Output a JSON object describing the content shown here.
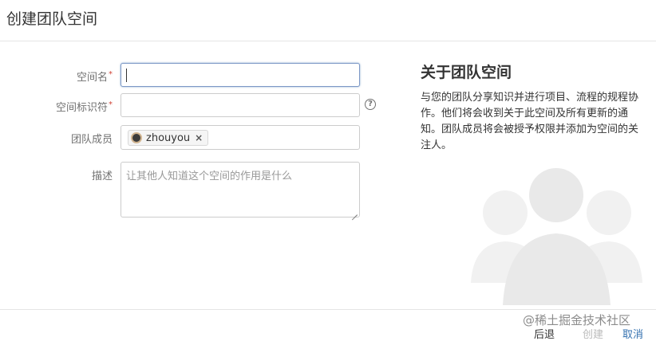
{
  "dialog": {
    "title": "创建团队空间"
  },
  "form": {
    "space_name": {
      "label": "空间名",
      "required_mark": "*",
      "value": ""
    },
    "space_key": {
      "label": "空间标识符",
      "required_mark": "*",
      "value": "",
      "help_icon": "question-circle-icon",
      "help_glyph": "?"
    },
    "members": {
      "label": "团队成员",
      "chips": [
        {
          "name": "zhouyou",
          "remove_glyph": "×"
        }
      ]
    },
    "description": {
      "label": "描述",
      "placeholder": "让其他人知道这个空间的作用是什么"
    }
  },
  "about": {
    "title": "关于团队空间",
    "text": "与您的团队分享知识并进行项目、流程的规程协作。他们将会收到关于此空间及所有更新的通知。团队成员将会被授予权限并添加为空间的关注人。"
  },
  "footer": {
    "back_label": "后退",
    "create_label": "创建",
    "cancel_label": "取消",
    "site_mark": "@稀土掘金技术社区"
  },
  "colors": {
    "link": "#3572b0",
    "required": "#d04437",
    "disabled": "#bbbbbb",
    "watermark": "#efefef"
  }
}
